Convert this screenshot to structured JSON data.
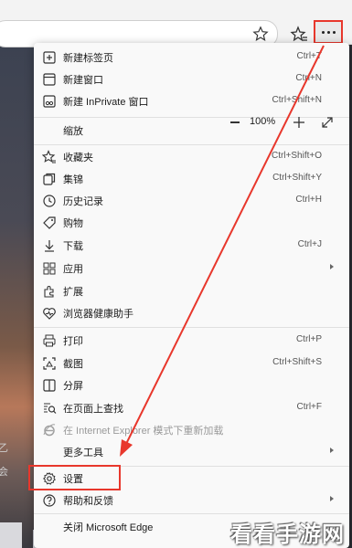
{
  "menu": {
    "items": [
      {
        "label": "新建标签页",
        "shortcut": "Ctrl+T",
        "icon": "new-tab-icon"
      },
      {
        "label": "新建窗口",
        "shortcut": "Ctrl+N",
        "icon": "new-window-icon"
      },
      {
        "label": "新建 InPrivate 窗口",
        "shortcut": "Ctrl+Shift+N",
        "icon": "inprivate-icon"
      },
      {
        "label": "缩放",
        "icon": "none"
      },
      {
        "label": "收藏夹",
        "shortcut": "Ctrl+Shift+O",
        "icon": "favorites-icon"
      },
      {
        "label": "集锦",
        "shortcut": "Ctrl+Shift+Y",
        "icon": "collections-icon"
      },
      {
        "label": "历史记录",
        "shortcut": "Ctrl+H",
        "icon": "history-icon"
      },
      {
        "label": "购物",
        "icon": "shopping-icon"
      },
      {
        "label": "下载",
        "shortcut": "Ctrl+J",
        "icon": "download-icon"
      },
      {
        "label": "应用",
        "icon": "apps-icon",
        "submenu": true
      },
      {
        "label": "扩展",
        "icon": "extensions-icon"
      },
      {
        "label": "浏览器健康助手",
        "icon": "health-icon"
      },
      {
        "label": "打印",
        "shortcut": "Ctrl+P",
        "icon": "print-icon"
      },
      {
        "label": "截图",
        "shortcut": "Ctrl+Shift+S",
        "icon": "screenshot-icon"
      },
      {
        "label": "分屏",
        "icon": "split-screen-icon"
      },
      {
        "label": "在页面上查找",
        "shortcut": "Ctrl+F",
        "icon": "find-icon"
      },
      {
        "label": "在 Internet Explorer 模式下重新加载",
        "icon": "ie-mode-icon",
        "disabled": true
      },
      {
        "label": "更多工具",
        "icon": "none",
        "submenu": true
      },
      {
        "label": "设置",
        "icon": "gear-icon"
      },
      {
        "label": "帮助和反馈",
        "icon": "help-icon",
        "submenu": true
      },
      {
        "label": "关闭 Microsoft Edge",
        "icon": "none"
      }
    ],
    "zoom_value": "100%",
    "zoom_minus": "—",
    "zoom_plus": "+"
  },
  "background": {
    "side_text_1": "乙",
    "side_text_2": "会"
  },
  "watermark": "看看手游网",
  "colors": {
    "highlight": "#e8372c",
    "menu_bg": "#f9f9f9"
  }
}
